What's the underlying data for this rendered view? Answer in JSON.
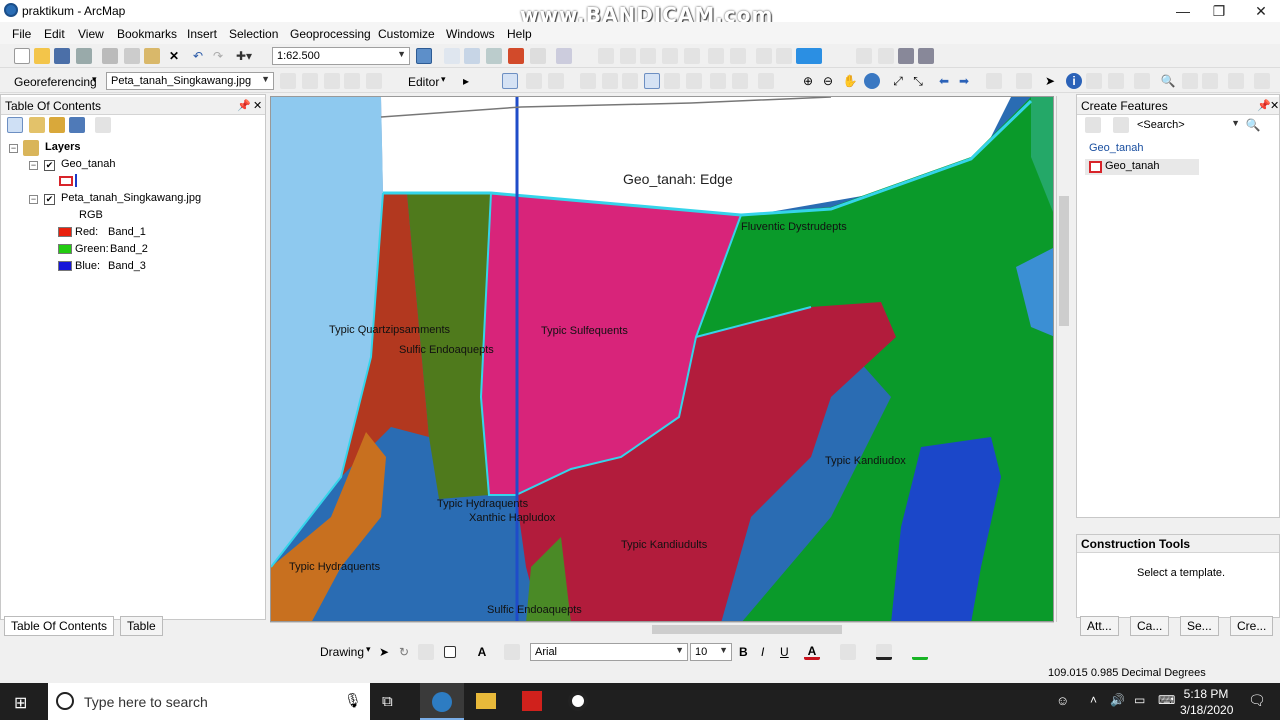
{
  "window": {
    "title": "praktikum - ArcMap",
    "watermark": "www.BANDICAM.com"
  },
  "menu": [
    "File",
    "Edit",
    "View",
    "Bookmarks",
    "Insert",
    "Selection",
    "Geoprocessing",
    "Customize",
    "Windows",
    "Help"
  ],
  "toolbar": {
    "scale": "1:62.500",
    "georeferencing": "Georeferencing",
    "georef_layer": "Peta_tanah_Singkawang.jpg",
    "editor": "Editor"
  },
  "toc": {
    "title": "Table Of Contents",
    "layers_label": "Layers",
    "layer1": "Geo_tanah",
    "layer2": "Peta_tanah_Singkawang.jpg",
    "rgb": "RGB",
    "bands": [
      {
        "name": "Red:",
        "band": "Band_1",
        "color": "#e8200c"
      },
      {
        "name": "Green:",
        "band": "Band_2",
        "color": "#22cc11"
      },
      {
        "name": "Blue:",
        "band": "Band_3",
        "color": "#1515d8"
      }
    ],
    "tab_toc": "Table Of Contents",
    "tab_table": "Table"
  },
  "map": {
    "edge_label": "Geo_tanah: Edge",
    "labels": [
      "Fluventic Dystrudepts",
      "Typic Quartzipsamments",
      "Sulfic Endoaquepts",
      "Typic Sulfequents",
      "Typic Kandiudox",
      "Typic Hydraquents",
      "Xanthic Hapludox",
      "Typic Kandiudults",
      "Typic Hydraquents",
      "Sulfic Endoaquepts"
    ]
  },
  "create_features": {
    "title": "Create Features",
    "search_placeholder": "<Search>",
    "group": "Geo_tanah",
    "template": "Geo_tanah"
  },
  "construction": {
    "title": "Construction Tools",
    "hint": "Select a template."
  },
  "right_tabs": [
    "Att...",
    "Ca...",
    "Se...",
    "Cre..."
  ],
  "drawing": {
    "label": "Drawing",
    "font": "Arial",
    "size": "10",
    "bold": "B",
    "italic": "I",
    "underline": "U"
  },
  "status": {
    "coords": "109.015  0.985 Decimal Degrees"
  },
  "taskbar": {
    "search_placeholder": "Type here to search",
    "time": "5:18 PM",
    "date": "3/18/2020"
  }
}
